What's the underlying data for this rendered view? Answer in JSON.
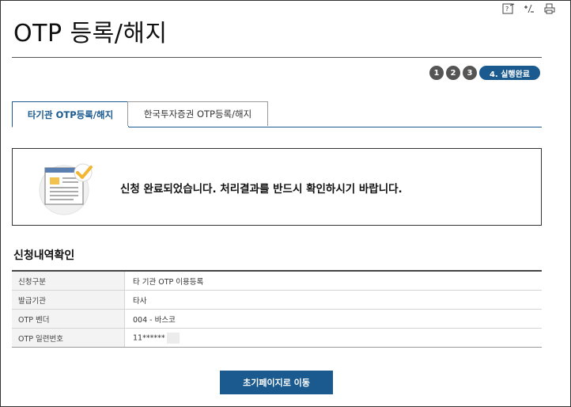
{
  "page": {
    "title": "OTP 등록/해지"
  },
  "tools": [
    {
      "icon": "help-icon"
    },
    {
      "icon": "text-size-icon"
    },
    {
      "icon": "print-icon"
    }
  ],
  "steps": {
    "numbers": [
      "1",
      "2",
      "3"
    ],
    "current": "4. 실행완료"
  },
  "tabs": [
    {
      "label": "타기관 OTP등록/해지",
      "active": true
    },
    {
      "label": "한국투자증권 OTP등록/해지",
      "active": false
    }
  ],
  "result": {
    "message": "신청 완료되었습니다. 처리결과를 반드시 확인하시기 바랍니다.",
    "icon": "document-check-icon"
  },
  "details": {
    "heading": "신청내역확인",
    "rows": [
      {
        "label": "신청구분",
        "value": "타 기관 OTP 이용등록"
      },
      {
        "label": "발급기관",
        "value": "타사"
      },
      {
        "label": "OTP 벤더",
        "value": "004 - 바스코"
      },
      {
        "label": "OTP 일련번호",
        "value": "11******"
      }
    ]
  },
  "actions": {
    "home_label": "초기페이지로 이동"
  },
  "colors": {
    "accent": "#1a5a8e",
    "step_gray": "#555555"
  }
}
